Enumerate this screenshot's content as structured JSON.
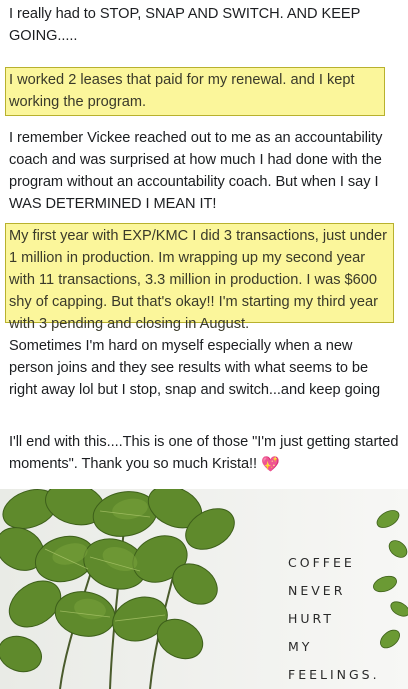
{
  "post": {
    "paragraph_1": "I really had to STOP, SNAP AND SWITCH. AND KEEP GOING.....",
    "highlight_1": "I worked 2 leases that paid for my renewal. and I kept working the program.",
    "paragraph_2": "I remember Vickee reached out to me as an accountability coach and was surprised at how much I had done with the program without an accountability coach. But when I say I WAS DETERMINED I MEAN IT!",
    "highlight_2": "My first year with EXP/KMC I did 3 transactions, just under 1 million in production. Im wrapping up my second year with 11 transactions, 3.3 million in production. I was $600 shy of capping. But that's okay!! I'm starting my third year with 3 pending and closing in August.",
    "paragraph_3": "Sometimes I'm hard on myself especially when a new person joins and they see results with what seems to be right away lol but I stop, snap and switch...and keep going",
    "paragraph_4": "I'll end with this....This is one of those \"I'm just getting started moments\". Thank you so much Krista!!",
    "heart_emoji": "💖",
    "highlight_color": "#fbf69b"
  },
  "photo": {
    "sign_lines": [
      "COFFEE",
      "NEVER",
      "HURT",
      "MY",
      "FEELINGS."
    ],
    "icon": "plant-wall-photo"
  }
}
